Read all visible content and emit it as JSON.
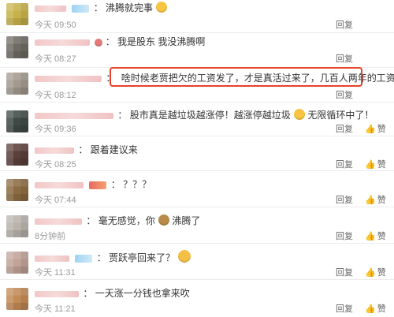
{
  "comments": [
    {
      "text": "沸腾就完事",
      "time": "今天 09:50",
      "reply": "回复",
      "like": "",
      "avatar_color": "#c7b24a"
    },
    {
      "text": "我是股东 我没沸腾啊",
      "time": "今天 08:27",
      "reply": "回复",
      "like": "",
      "avatar_color": "#6f6a63"
    },
    {
      "text": "啥时候老贾把欠的工资发了，才是真活过来了，几百人两年的工资呢",
      "time": "今天 08:12",
      "reply": "回复",
      "like": "",
      "avatar_color": "#a39a8f"
    },
    {
      "text": "股市真是越垃圾越涨停！越涨停越垃圾",
      "text_suffix": "无限循环中了！",
      "time": "今天 09:36",
      "reply": "回复",
      "like": "赞",
      "avatar_color": "#3f4a45"
    },
    {
      "text": "跟着建议来",
      "time": "今天 08:25",
      "reply": "回复",
      "like": "赞",
      "avatar_color": "#5a3f3b"
    },
    {
      "text": "？？？",
      "time": "今天 07:44",
      "reply": "回复",
      "like": "赞",
      "avatar_color": "#8c6b42"
    },
    {
      "text": "毫无感觉，你",
      "text_suffix": "沸腾了",
      "time": "8分钟前",
      "reply": "回复",
      "like": "赞",
      "avatar_color": "#b9b3ac"
    },
    {
      "text": "贾跃亭回来了？",
      "time": "今天 11:31",
      "reply": "回复",
      "like": "赞",
      "avatar_color": "#c1a397"
    },
    {
      "text": "一天涨一分钱也拿来吹",
      "time": "今天 11:21",
      "reply": "回复",
      "like": "赞",
      "avatar_color": "#c38a56"
    }
  ]
}
